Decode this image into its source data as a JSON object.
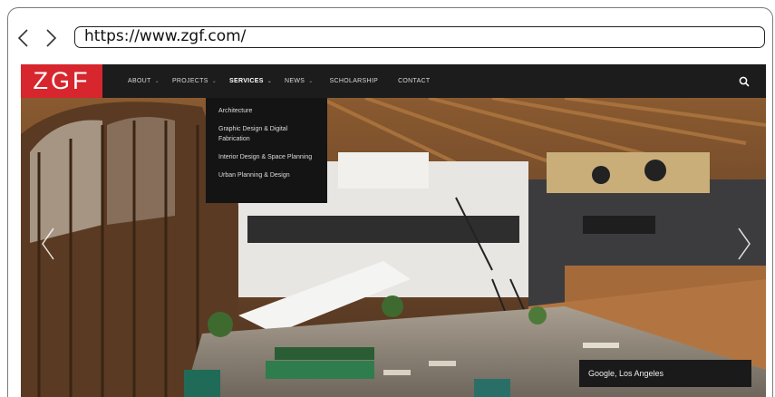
{
  "browser": {
    "url": "https://www.zgf.com/",
    "back_icon": "chevron-left-icon",
    "forward_icon": "chevron-right-icon"
  },
  "site": {
    "logo": "ZGF",
    "menu": [
      {
        "label": "ABOUT",
        "has_dropdown": true
      },
      {
        "label": "PROJECTS",
        "has_dropdown": true
      },
      {
        "label": "SERVICES",
        "has_dropdown": true,
        "active": true
      },
      {
        "label": "NEWS",
        "has_dropdown": true
      },
      {
        "label": "SCHOLARSHIP",
        "has_dropdown": false
      },
      {
        "label": "CONTACT",
        "has_dropdown": false
      }
    ],
    "caret": "⌄",
    "search_icon": "search-icon",
    "services_dropdown": [
      "Architecture",
      "Graphic Design & Digital Fabrication",
      "Interior Design & Space Planning",
      "Urban Planning & Design"
    ]
  },
  "hero": {
    "caption": "Google, Los Angeles",
    "prev_icon": "chevron-left-icon",
    "next_icon": "chevron-right-icon"
  },
  "colors": {
    "brand_red": "#d7262e",
    "header_bg": "#1c1c1c",
    "dropdown_bg": "#141414"
  }
}
